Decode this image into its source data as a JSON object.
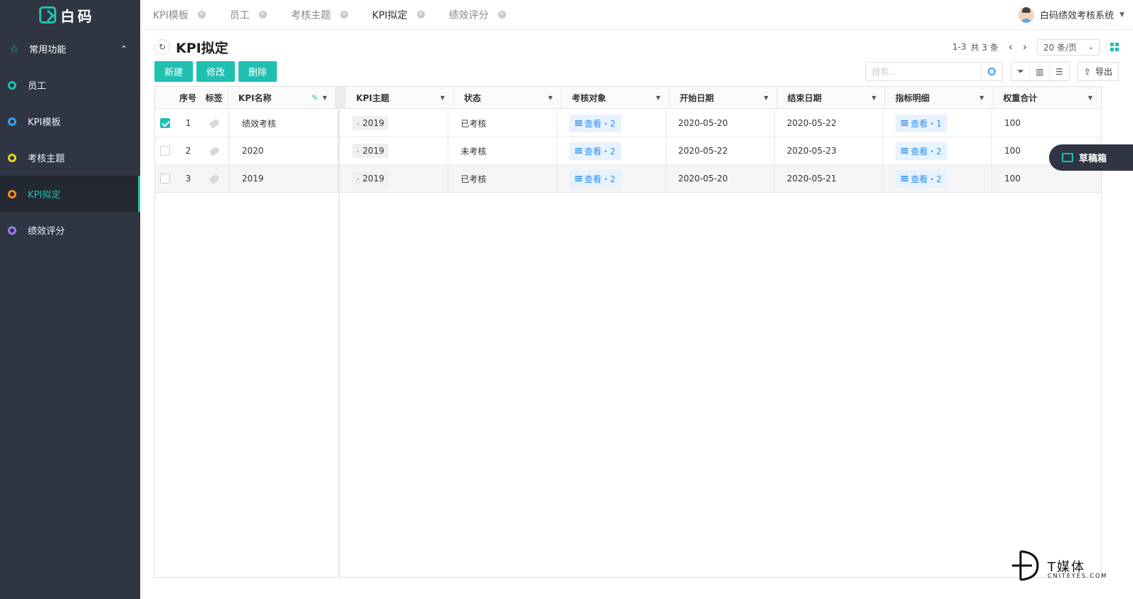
{
  "brand": {
    "name": "白码"
  },
  "sidebar": {
    "group_label": "常用功能",
    "items": [
      {
        "label": "员工",
        "color": "#20c0b0"
      },
      {
        "label": "KPI模板",
        "color": "#3aa0f0"
      },
      {
        "label": "考核主题",
        "color": "#e8d51e"
      },
      {
        "label": "KPI拟定",
        "color": "#f08a1e"
      },
      {
        "label": "绩效评分",
        "color": "#9b7cf0"
      }
    ]
  },
  "tabs": [
    {
      "label": "KPI模板"
    },
    {
      "label": "员工"
    },
    {
      "label": "考核主题"
    },
    {
      "label": "KPI拟定"
    },
    {
      "label": "绩效评分"
    }
  ],
  "user": {
    "name": "白码绩效考核系统"
  },
  "page": {
    "title": "KPI拟定",
    "pager_range": "1-3",
    "pager_total": "共 3 条",
    "page_size": "20 条/页"
  },
  "toolbar": {
    "new_label": "新建",
    "edit_label": "修改",
    "delete_label": "删除",
    "search_placeholder": "搜索...",
    "export_label": "导出"
  },
  "table": {
    "headers": {
      "index": "序号",
      "tag": "标签",
      "name": "KPI名称",
      "theme": "KPI主题",
      "status": "状态",
      "target": "考核对象",
      "start": "开始日期",
      "end": "结束日期",
      "detail": "指标明细",
      "weight": "权重合计"
    },
    "rows": [
      {
        "checked": true,
        "index": "1",
        "name": "绩效考核",
        "theme": "2019",
        "status": "已考核",
        "target": "查看・2",
        "start": "2020-05-20",
        "end": "2020-05-22",
        "detail": "查看・1",
        "weight": "100"
      },
      {
        "checked": false,
        "index": "2",
        "name": "2020",
        "theme": "2019",
        "status": "未考核",
        "target": "查看・2",
        "start": "2020-05-22",
        "end": "2020-05-23",
        "detail": "查看・2",
        "weight": "100"
      },
      {
        "checked": false,
        "index": "3",
        "name": "2019",
        "theme": "2019",
        "status": "已考核",
        "target": "查看・2",
        "start": "2020-05-20",
        "end": "2020-05-21",
        "detail": "查看・2",
        "weight": "100"
      }
    ]
  },
  "draft": {
    "label": "草稿箱"
  },
  "watermark": {
    "text": "T媒体",
    "sub": "CNITEYES.COM"
  }
}
